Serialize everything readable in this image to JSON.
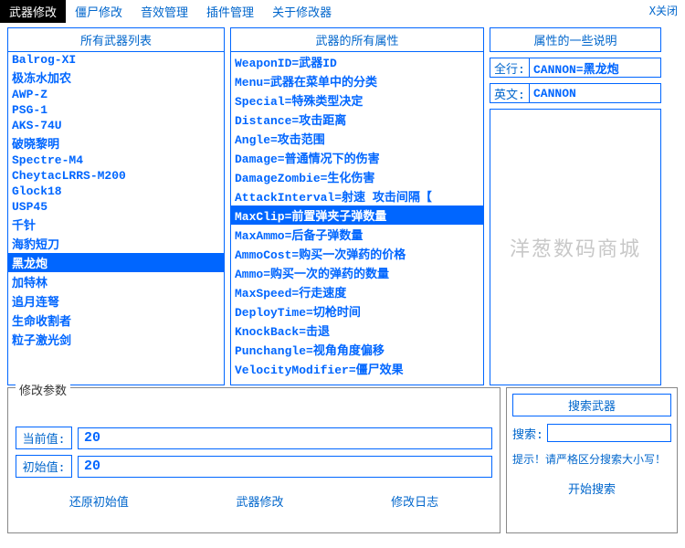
{
  "menu": {
    "tabs": [
      "武器修改",
      "僵尸修改",
      "音效管理",
      "插件管理",
      "关于修改器"
    ],
    "active": 0,
    "close": "X关闭"
  },
  "weapons": {
    "header": "所有武器列表",
    "items": [
      "Balrog-XI",
      "极冻水加农",
      "AWP-Z",
      "PSG-1",
      "AKS-74U",
      "破晓黎明",
      "Spectre-M4",
      "CheytacLRRS-M200",
      "Glock18",
      "USP45",
      "千针",
      "海豹短刀",
      "黑龙炮",
      "加特林",
      "追月连弩",
      "生命收割者",
      "粒子激光剑"
    ],
    "selected": 12
  },
  "props": {
    "header": "武器的所有属性",
    "items": [
      "WeaponID=武器ID",
      "Menu=武器在菜单中的分类",
      "Special=特殊类型决定",
      "Distance=攻击距离",
      "Angle=攻击范围",
      "Damage=普通情况下的伤害",
      "DamageZombie=生化伤害",
      "AttackInterval=射速 攻击间隔【",
      "MaxClip=前置弹夹子弹数量",
      "MaxAmmo=后备子弹数量",
      "AmmoCost=购买一次弹药的价格",
      "Ammo=购买一次的弹药的数量",
      "MaxSpeed=行走速度",
      "DeployTime=切枪时间",
      "KnockBack=击退",
      "Punchangle=视角角度偏移",
      "VelocityModifier=僵尸效果"
    ],
    "selected": 8
  },
  "right": {
    "header": "属性的一些说明",
    "full_label": "全行:",
    "full_value": "CANNON=黑龙炮",
    "eng_label": "英文:",
    "eng_value": "CANNON",
    "watermark": "洋葱数码商城"
  },
  "params": {
    "legend": "修改参数",
    "current_label": "当前值:",
    "current_value": "20",
    "initial_label": "初始值:",
    "initial_value": "20",
    "btn_restore": "还原初始值",
    "btn_modify": "武器修改",
    "btn_log": "修改日志"
  },
  "search": {
    "header": "搜索武器",
    "label": "搜索:",
    "value": "",
    "hint": "提示！请严格区分搜索大小写！",
    "btn": "开始搜索"
  }
}
